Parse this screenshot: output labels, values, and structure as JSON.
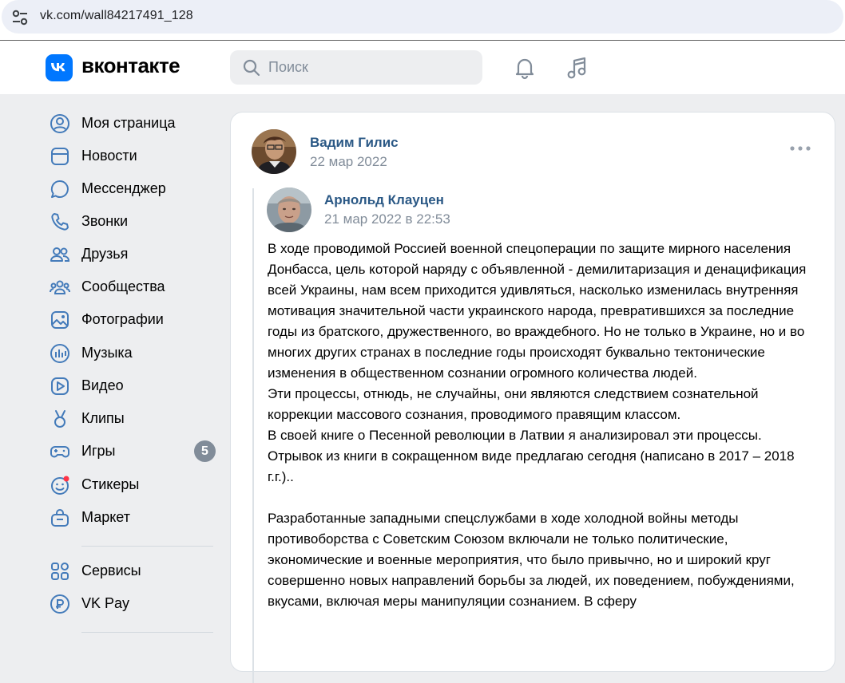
{
  "browser": {
    "url": "vk.com/wall84217491_128"
  },
  "header": {
    "logo_text": "вконтакте",
    "search_placeholder": "Поиск"
  },
  "sidebar": {
    "items": [
      {
        "label": "Моя страница",
        "icon": "user-circle-icon"
      },
      {
        "label": "Новости",
        "icon": "news-icon"
      },
      {
        "label": "Мессенджер",
        "icon": "chat-icon"
      },
      {
        "label": "Звонки",
        "icon": "phone-icon"
      },
      {
        "label": "Друзья",
        "icon": "friends-icon"
      },
      {
        "label": "Сообщества",
        "icon": "communities-icon"
      },
      {
        "label": "Фотографии",
        "icon": "photo-icon"
      },
      {
        "label": "Музыка",
        "icon": "music-icon"
      },
      {
        "label": "Видео",
        "icon": "video-icon"
      },
      {
        "label": "Клипы",
        "icon": "clips-icon"
      },
      {
        "label": "Игры",
        "icon": "gamepad-icon",
        "badge": "5"
      },
      {
        "label": "Стикеры",
        "icon": "sticker-icon"
      },
      {
        "label": "Маркет",
        "icon": "market-icon"
      }
    ],
    "extra_items": [
      {
        "label": "Сервисы",
        "icon": "services-icon"
      },
      {
        "label": "VK Pay",
        "icon": "vkpay-icon"
      }
    ]
  },
  "post": {
    "author": "Вадим Гилис",
    "date": "22 мар 2022",
    "repost": {
      "author": "Арнольд Клауцен",
      "date": "21 мар 2022 в 22:53",
      "paragraphs": [
        "В ходе проводимой Россией военной спецоперации по защите мирного населения Донбасса, цель которой наряду с объявленной - демилитаризация и денацификация всей Украины, нам всем приходится удивляться, насколько изменилась внутренняя мотивация значительной части украинского народа, превратившихся за последние годы из братского, дружественного, во враждебного. Но не только в Украине, но и во многих других странах в последние годы происходят буквально тектонические изменения в общественном сознании огромного количества людей.",
        "Эти процессы, отнюдь, не случайны, они являются следствием сознательной коррекции массового сознания, проводимого правящим классом.",
        "В своей книге о Песенной революции в Латвии я анализировал эти процессы. Отрывок из книги в сокращенном виде предлагаю сегодня (написано в 2017 – 2018 г.г.)..",
        "Разработанные западными спецслужбами в ходе холодной войны методы противоборства с Советским Союзом включали не только политические, экономические и военные мероприятия, что было привычно, но и широкий круг совершенно новых направлений борьбы за людей, их поведением, побуждениями, вкусами, включая меры манипуляции сознанием. В сферу"
      ]
    }
  },
  "colors": {
    "accent": "#0077ff",
    "link": "#2a5885",
    "secondary_text": "#818c99",
    "page_bg": "#edeef0",
    "badge_bg": "#818c99",
    "notification_dot": "#ff3347"
  }
}
